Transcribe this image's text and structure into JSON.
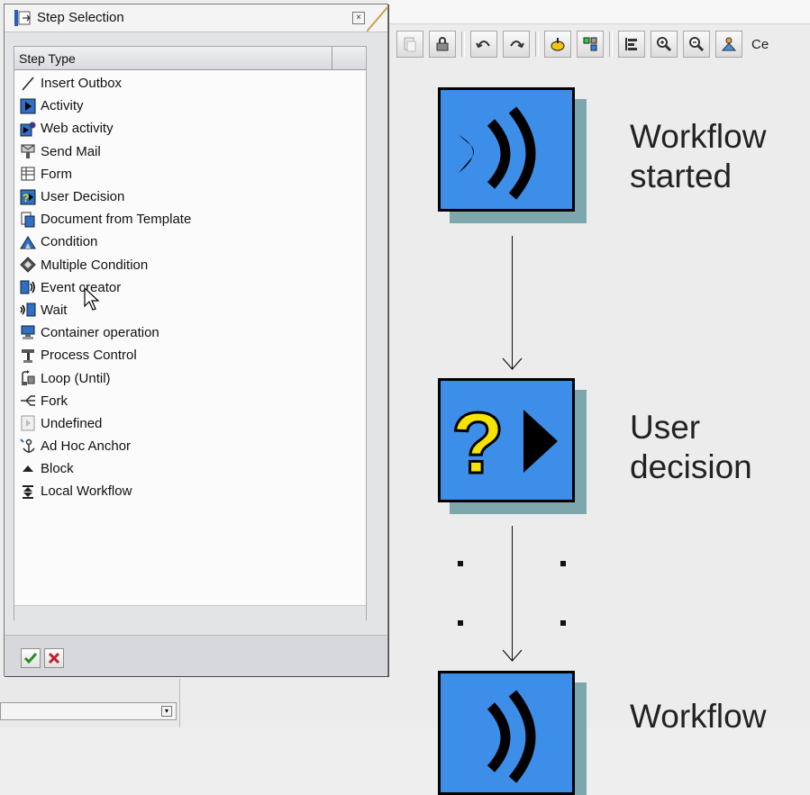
{
  "dialog": {
    "title": "Step Selection",
    "column_header": "Step Type",
    "items": [
      {
        "label": "Insert Outbox",
        "icon": "line-icon"
      },
      {
        "label": "Activity",
        "icon": "activity-icon"
      },
      {
        "label": "Web activity",
        "icon": "web-activity-icon"
      },
      {
        "label": "Send Mail",
        "icon": "send-mail-icon"
      },
      {
        "label": "Form",
        "icon": "form-icon"
      },
      {
        "label": "User Decision",
        "icon": "user-decision-icon"
      },
      {
        "label": "Document from Template",
        "icon": "document-template-icon"
      },
      {
        "label": "Condition",
        "icon": "condition-icon"
      },
      {
        "label": "Multiple Condition",
        "icon": "multiple-condition-icon"
      },
      {
        "label": "Event creator",
        "icon": "event-creator-icon"
      },
      {
        "label": "Wait",
        "icon": "wait-icon"
      },
      {
        "label": "Container operation",
        "icon": "container-operation-icon"
      },
      {
        "label": "Process Control",
        "icon": "process-control-icon"
      },
      {
        "label": "Loop (Until)",
        "icon": "loop-icon"
      },
      {
        "label": "Fork",
        "icon": "fork-icon"
      },
      {
        "label": "Undefined",
        "icon": "undefined-icon"
      },
      {
        "label": "Ad Hoc Anchor",
        "icon": "ad-hoc-anchor-icon"
      },
      {
        "label": "Block",
        "icon": "block-icon"
      },
      {
        "label": "Local Workflow",
        "icon": "local-workflow-icon"
      }
    ]
  },
  "toolbar": {
    "partial_label": "Ce"
  },
  "workflow": {
    "node1_label_1": "Workflow",
    "node1_label_2": "started",
    "node2_label_1": "User",
    "node2_label_2": "decision",
    "node3_label_1": "Workflow"
  },
  "colors": {
    "node_blue": "#3d8ee9",
    "node_shadow": "#7ea7ad"
  }
}
